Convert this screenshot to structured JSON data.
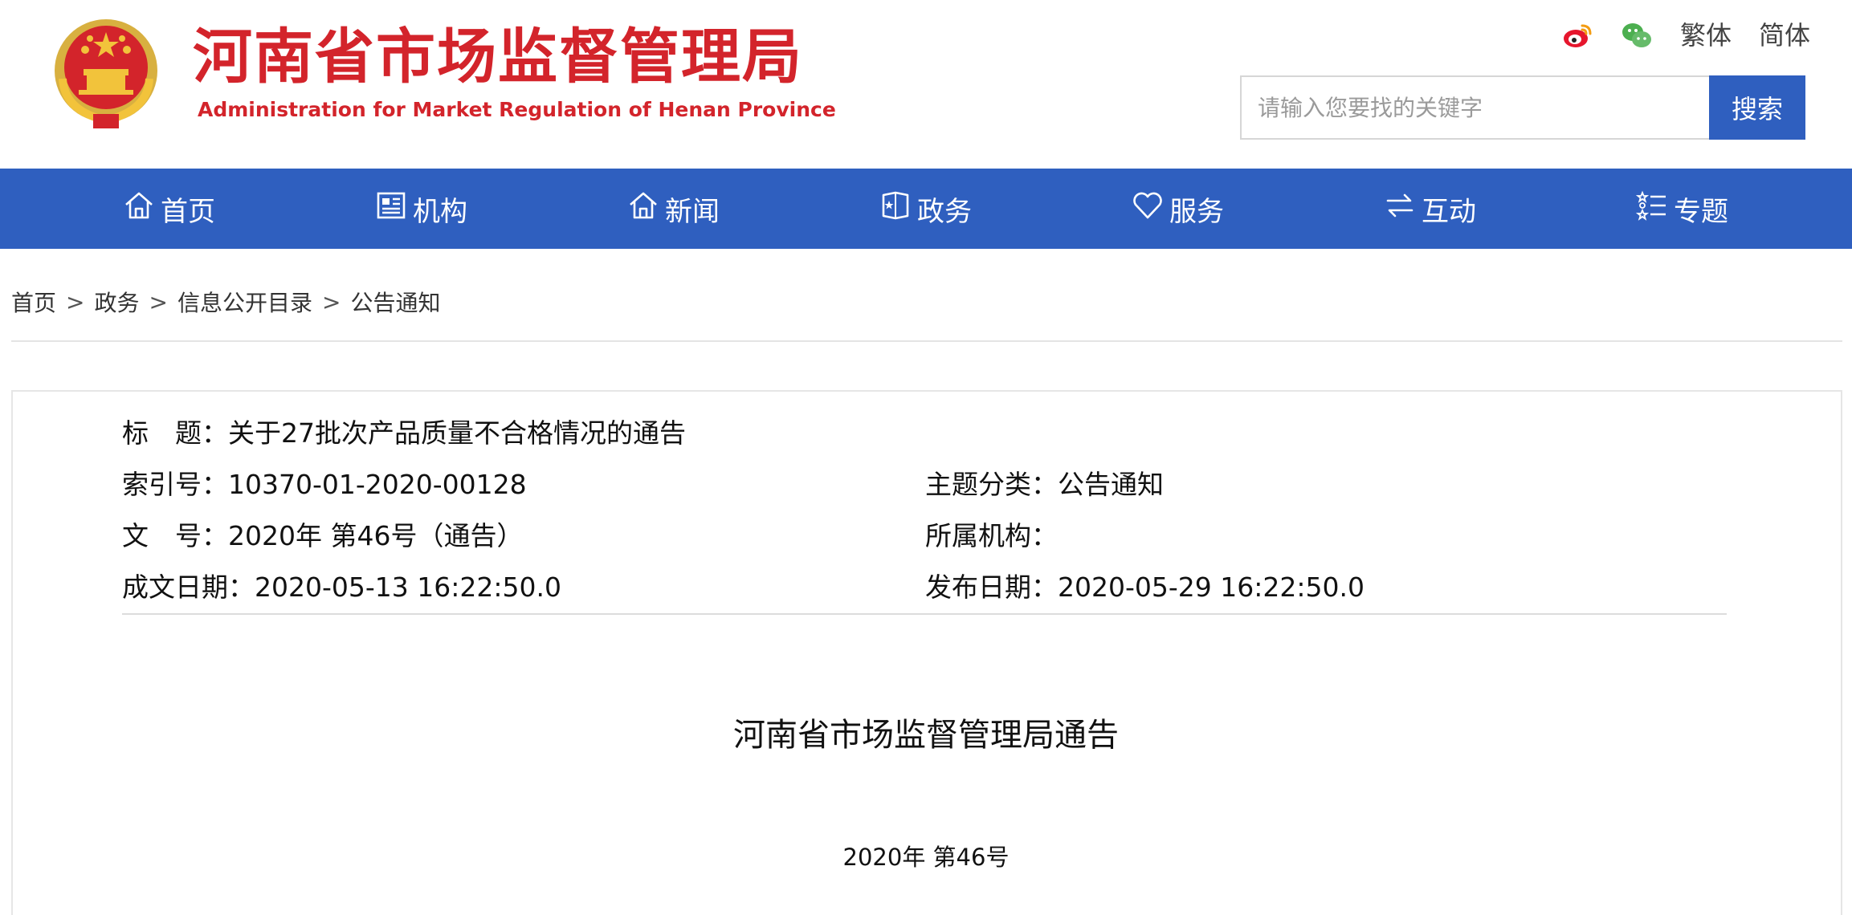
{
  "header": {
    "title": "河南省市场监督管理局",
    "subtitle": "Administration for Market Regulation of Henan Province",
    "top_links": {
      "weibo_icon": "weibo-icon",
      "wechat_icon": "wechat-icon",
      "traditional": "繁体",
      "simplified": "简体"
    },
    "search": {
      "placeholder": "请输入您要找的关键字",
      "value": "",
      "button_label": "搜索"
    }
  },
  "nav": {
    "items": [
      {
        "label": "首页",
        "icon": "home-icon"
      },
      {
        "label": "机构",
        "icon": "organization-icon"
      },
      {
        "label": "新闻",
        "icon": "news-icon"
      },
      {
        "label": "政务",
        "icon": "government-affairs-icon"
      },
      {
        "label": "服务",
        "icon": "heart-icon"
      },
      {
        "label": "互动",
        "icon": "exchange-arrows-icon"
      },
      {
        "label": "专题",
        "icon": "topics-list-icon"
      }
    ]
  },
  "breadcrumb": {
    "items": [
      "首页",
      "政务",
      "信息公开目录",
      "公告通知"
    ],
    "separator": ">"
  },
  "document": {
    "meta": {
      "title_label": "标　题：",
      "title_value": "关于27批次产品质量不合格情况的通告",
      "index_label": "索引号：",
      "index_value": "10370-01-2020-00128",
      "category_label": "主题分类：",
      "category_value": "公告通知",
      "doc_no_label": "文　号：",
      "doc_no_value": "2020年 第46号（通告）",
      "org_label": "所属机构：",
      "org_value": "",
      "created_label": "成文日期：",
      "created_value": "2020-05-13 16:22:50.0",
      "published_label": "发布日期：",
      "published_value": "2020-05-29 16:22:50.0"
    },
    "heading": "河南省市场监督管理局通告",
    "number": "2020年 第46号"
  },
  "colors": {
    "brand_red": "#d3242b",
    "nav_blue": "#2f5fbf",
    "emblem_gold": "#f2c33b"
  }
}
